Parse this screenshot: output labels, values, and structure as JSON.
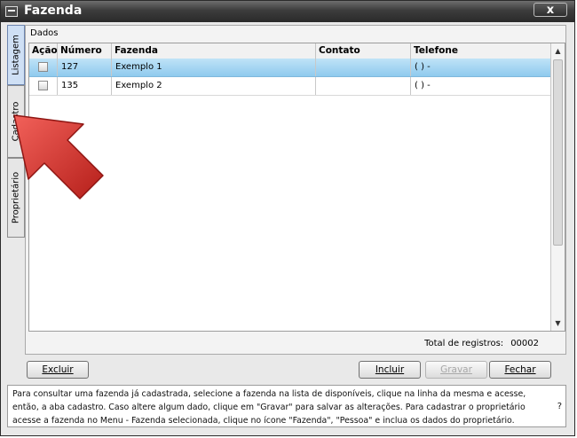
{
  "window": {
    "title": "Fazenda",
    "close_label": "x"
  },
  "side_tabs": [
    "Listagem",
    "Cadastro",
    "Proprietário"
  ],
  "panel": {
    "section_label": "Dados"
  },
  "table": {
    "columns": [
      "Ação",
      "Número",
      "Fazenda",
      "Contato",
      "Telefone"
    ],
    "rows": [
      {
        "numero": "127",
        "fazenda": "Exemplo 1",
        "contato": "",
        "telefone": "(  )   -",
        "selected": true
      },
      {
        "numero": "135",
        "fazenda": "Exemplo 2",
        "contato": "",
        "telefone": "(  )   -",
        "selected": false
      }
    ]
  },
  "footer": {
    "total_label": "Total de registros:",
    "total_value": "00002"
  },
  "buttons": {
    "excluir": "Excluir",
    "incluir": "Incluir",
    "gravar": "Gravar",
    "fechar": "Fechar"
  },
  "help_text": "Para consultar uma fazenda já cadastrada, selecione a fazenda na lista de disponíveis, clique na linha da mesma e acesse, então, a aba cadastro. Caso altere algum dado, clique em \"Gravar\" para salvar as alterações. Para cadastrar o proprietário acesse a fazenda no Menu - Fazenda selecionada, clique no ícone \"Fazenda\", \"Pessoa\" e inclua os dados do proprietário.",
  "help_button": "?",
  "colors": {
    "selection": "#9fd2f2",
    "annotation_arrow": "#d8322b"
  }
}
